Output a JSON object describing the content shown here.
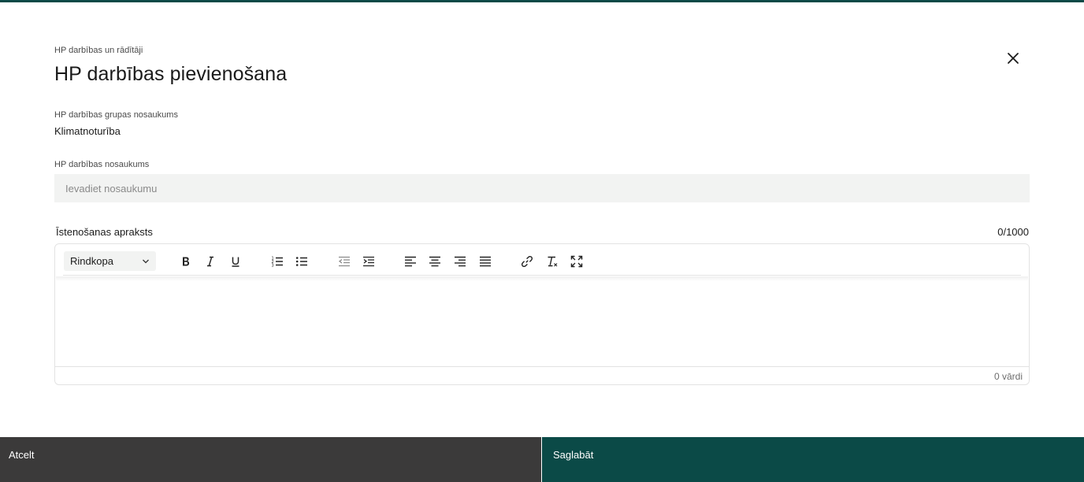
{
  "header": {
    "breadcrumb": "HP darbības un rādītāji",
    "title": "HP darbības pievienošana"
  },
  "group_name": {
    "label": "HP darbības grupas nosaukums",
    "value": "Klimatnoturība"
  },
  "action_name": {
    "label": "HP darbības nosaukums",
    "placeholder": "Ievadiet nosaukumu",
    "value": ""
  },
  "description": {
    "label": "Īstenošanas apraksts",
    "char_counter": "0/1000",
    "editor": {
      "block_format": "Rindkopa",
      "toolbar_icons": [
        "bold-icon",
        "italic-icon",
        "underline-icon",
        "ordered-list-icon",
        "bullet-list-icon",
        "outdent-icon",
        "indent-icon",
        "align-left-icon",
        "align-center-icon",
        "align-right-icon",
        "align-justify-icon",
        "link-icon",
        "clear-formatting-icon",
        "fullscreen-icon"
      ],
      "content": "",
      "word_count": "0 vārdi"
    }
  },
  "footer": {
    "cancel_label": "Atcelt",
    "save_label": "Saglabāt"
  },
  "colors": {
    "accent": "#0b4a47",
    "cancel_bg": "#3b3a3a",
    "input_bg": "#f2f3f2"
  }
}
